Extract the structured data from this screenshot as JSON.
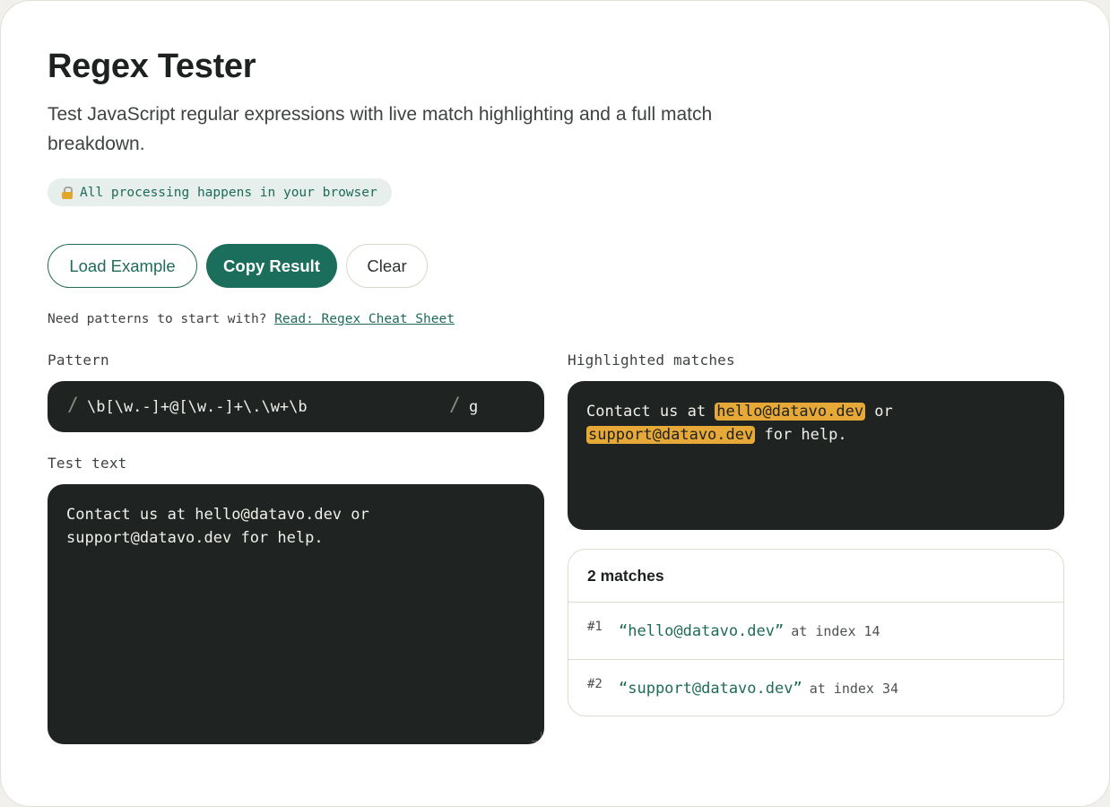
{
  "page": {
    "title": "Regex Tester",
    "subtitle": "Test JavaScript regular expressions with live match highlighting and a full match breakdown.",
    "privacy_badge": "All processing happens in your browser"
  },
  "actions": {
    "load_example": "Load Example",
    "copy_result": "Copy Result",
    "clear": "Clear"
  },
  "hint": {
    "text": "Need patterns to start with?",
    "link": "Read: Regex Cheat Sheet"
  },
  "pattern": {
    "label": "Pattern",
    "delimiter": "/",
    "value": "\\b[\\w.-]+@[\\w.-]+\\.\\w+\\b",
    "flags": "g"
  },
  "test_text": {
    "label": "Test text",
    "value": "Contact us at hello@datavo.dev or support@datavo.dev for help."
  },
  "highlighted": {
    "label": "Highlighted matches",
    "segments": {
      "s0": "Contact us at ",
      "m1": "hello@datavo.dev",
      "s1": " or ",
      "m2": "support@datavo.dev",
      "s2": " for help."
    }
  },
  "matches": {
    "count_label": "2 matches",
    "items": [
      {
        "num": "#1",
        "value": "“hello@datavo.dev”",
        "index_label": "at index 14"
      },
      {
        "num": "#2",
        "value": "“support@datavo.dev”",
        "index_label": "at index 34"
      }
    ]
  },
  "colors": {
    "accent": "#1a6e5b",
    "highlight": "#e6a937",
    "editor_bg": "#1f2321"
  },
  "icons": {
    "privacy": "lock-icon"
  }
}
